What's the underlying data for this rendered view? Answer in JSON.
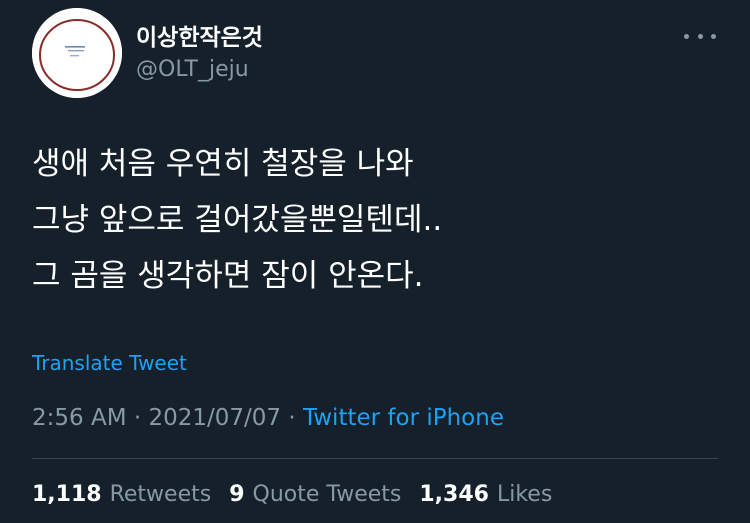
{
  "author": {
    "display_name": "이상한작은것",
    "handle": "@OLT_jeju"
  },
  "tweet": {
    "lines": [
      "생애 처음 우연히 철장을 나와",
      "그냥 앞으로 걸어갔을뿐일텐데..",
      "그 곰을 생각하면 잠이 안온다."
    ],
    "translate_label": "Translate Tweet",
    "time": "2:56 AM",
    "separator": "·",
    "date": "2021/07/07",
    "source": "Twitter for iPhone"
  },
  "stats": {
    "retweets_count": "1,118",
    "retweets_label": "Retweets",
    "quotes_count": "9",
    "quotes_label": "Quote Tweets",
    "likes_count": "1,346",
    "likes_label": "Likes"
  },
  "icons": {
    "more": "more-horizontal-icon"
  },
  "colors": {
    "background": "#15202b",
    "accent": "#1da1f2",
    "muted": "#8899a6",
    "divider": "#38444d"
  }
}
